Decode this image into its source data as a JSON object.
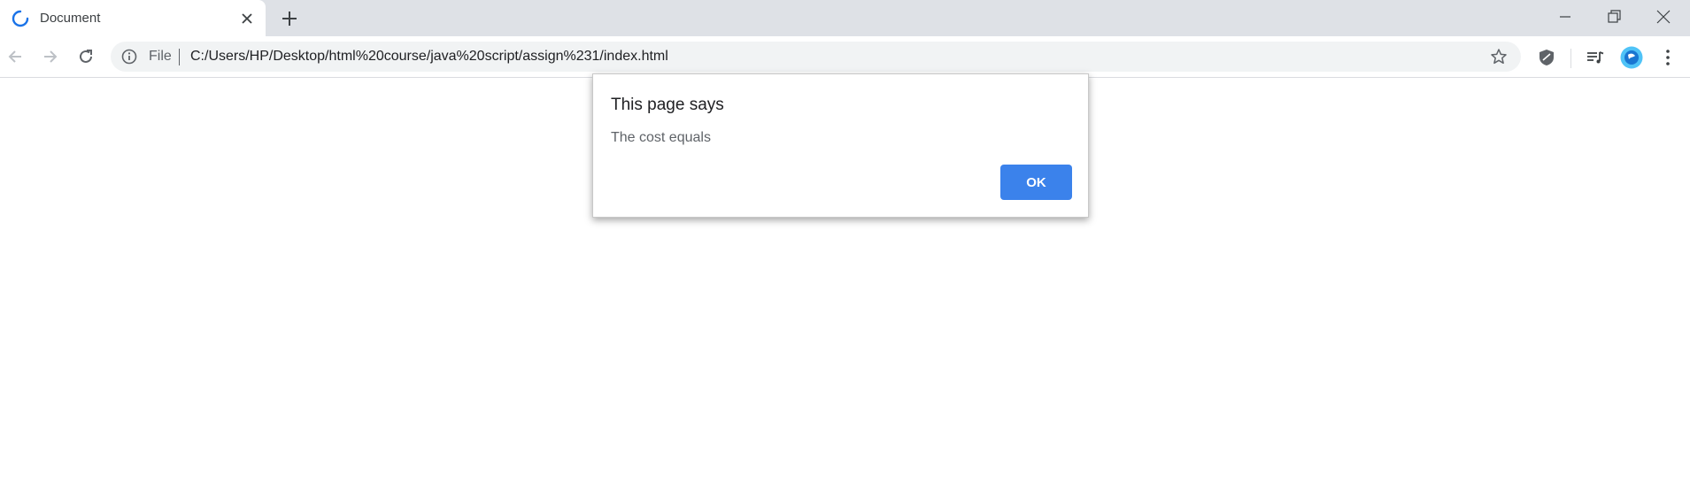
{
  "browser": {
    "tab": {
      "title": "Document",
      "loading": true
    },
    "omnibox": {
      "security_label": "File",
      "url": "C:/Users/HP/Desktop/html%20course/java%20script/assign%231/index.html"
    },
    "icons": [
      "spinner-icon",
      "close-icon",
      "plus-icon",
      "minimize-icon",
      "restore-icon",
      "window-close-icon",
      "back-icon",
      "forward-icon",
      "reload-icon",
      "info-icon",
      "star-icon",
      "shield-extension-icon",
      "media-queue-icon",
      "profile-avatar-icon",
      "kebab-menu-icon"
    ]
  },
  "dialog": {
    "title": "This page says",
    "message": "The cost equals",
    "ok_label": "OK"
  },
  "colors": {
    "tabstrip": "#dee1e6",
    "omnibox": "#f1f3f4",
    "accent": "#3b82eb"
  }
}
